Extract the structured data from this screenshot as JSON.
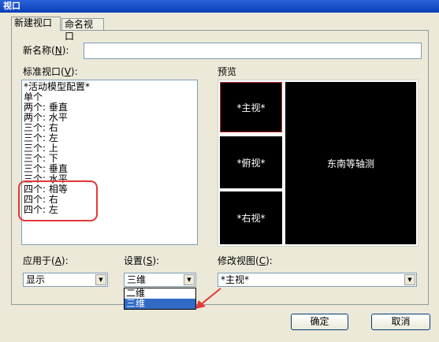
{
  "window": {
    "title": "视口"
  },
  "tabs": [
    {
      "label": "新建视口",
      "active": true
    },
    {
      "label": "命名视口",
      "active": false
    }
  ],
  "new_name": {
    "label": "新名称",
    "key": "N",
    "value": ""
  },
  "standard_viewports": {
    "label": "标准视口",
    "key": "V",
    "items": [
      "*活动模型配置*",
      "单个",
      "两个: 垂直",
      "两个: 水平",
      "三个: 右",
      "三个: 左",
      "三个: 上",
      "三个: 下",
      "三个: 垂直",
      "三个: 水平",
      "四个: 相等",
      "四个: 右",
      "四个: 左"
    ]
  },
  "preview": {
    "label": "预览",
    "viewports": {
      "main": "*主视*",
      "top": "*俯视*",
      "right": "*右视*",
      "iso": "东南等轴测"
    }
  },
  "apply_to": {
    "label": "应用于",
    "key": "A",
    "value": "显示"
  },
  "setup": {
    "label": "设置",
    "key": "S",
    "value": "三维",
    "options": [
      "二维",
      "三维"
    ],
    "selected_index": 1
  },
  "modify_view": {
    "label": "修改视图",
    "key": "C",
    "value": "*主视*"
  },
  "buttons": {
    "ok": "确定",
    "cancel": "取消"
  },
  "colors": {
    "titlebar": "#0a3fb8",
    "highlight_red": "#e23838",
    "selection": "#316ac5"
  }
}
